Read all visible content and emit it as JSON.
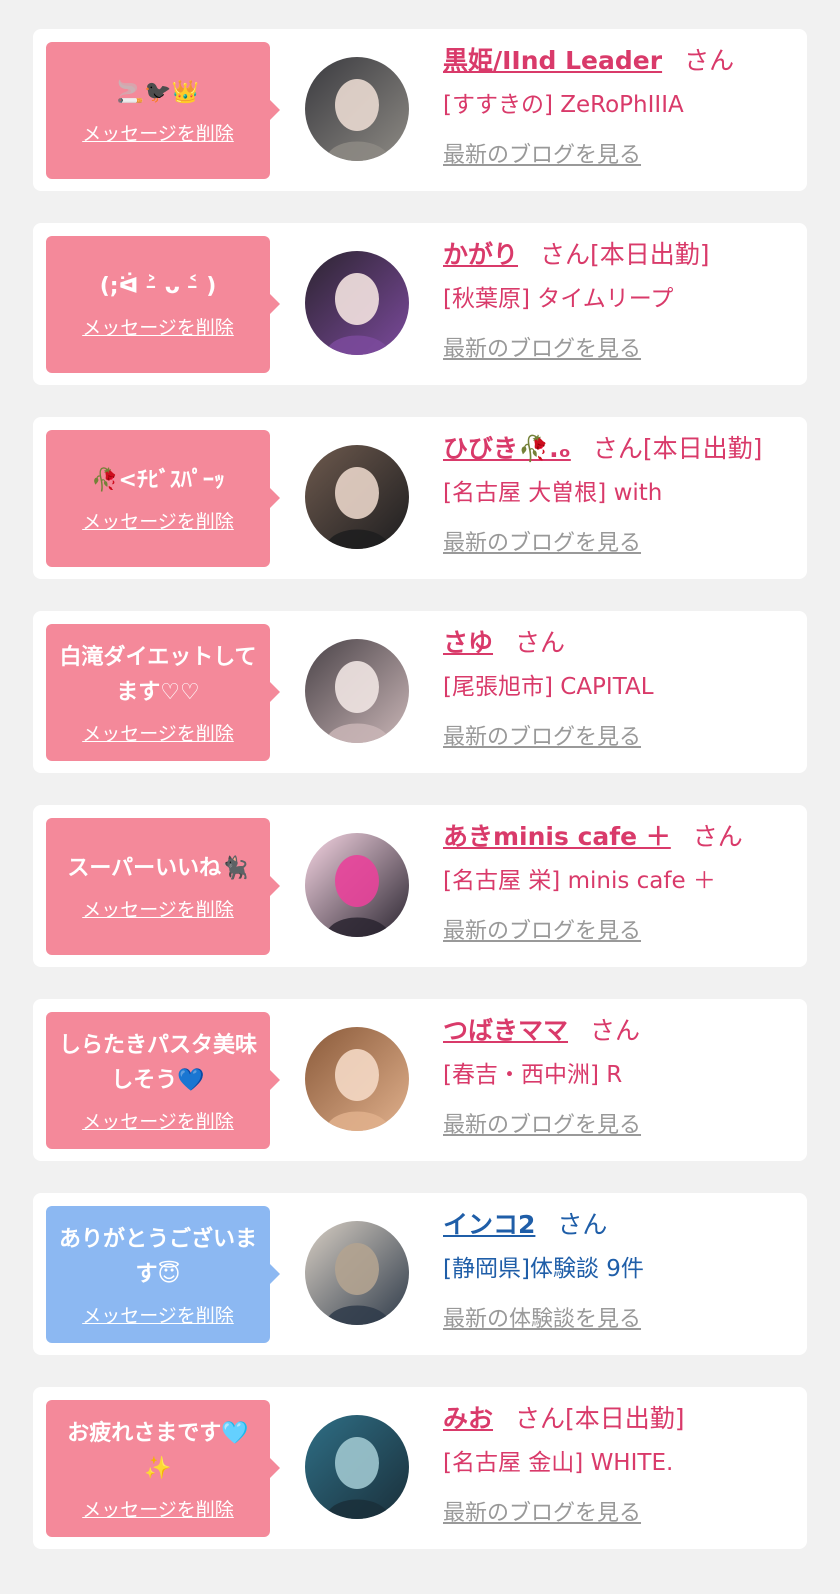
{
  "delete_label": "メッセージを削除",
  "colors": {
    "pink": "#f4899a",
    "blue": "#8cb8f2",
    "pink_text": "#d93a6a",
    "blue_text": "#1f5ea8",
    "link_gray": "#999999",
    "card_bg": "#ffffff",
    "page_bg": "#f1f1f1"
  },
  "honorific": "さん",
  "cards": [
    {
      "message": "🚬🐦‍⬛👑",
      "bubble_color": "pink",
      "name": "黒姫/IInd Leader",
      "status": "",
      "shop": "[すすきの] ZeRoPhIIIA",
      "link": "最新のブログを見る",
      "avatar": {
        "c1": "#3a3a3f",
        "c2": "#8d8a84",
        "c3": "#e9d9d0"
      }
    },
    {
      "message": "(;ᐛ ˃̵ ᴗ ˂̵ )",
      "bubble_color": "pink",
      "name": "かがり",
      "status": "[本日出勤]",
      "shop": "[秋葉原] タイムリープ",
      "link": "最新のブログを見る",
      "avatar": {
        "c1": "#2c2430",
        "c2": "#7b4a9c",
        "c3": "#f3e2e0"
      }
    },
    {
      "message": "🥀<ﾁﾋﾞｽﾊﾟｰｯ",
      "bubble_color": "pink",
      "name": "ひびき🥀.ₒ",
      "status": "[本日出勤]",
      "shop": "[名古屋 大曽根] with",
      "link": "最新のブログを見る",
      "avatar": {
        "c1": "#6e5a4e",
        "c2": "#1d1d1f",
        "c3": "#e8d4c8"
      }
    },
    {
      "message": "白滝ダイエットしてます♡♡",
      "bubble_color": "pink",
      "name": "さゆ",
      "status": "",
      "shop": "[尾張旭市] CAPITAL",
      "link": "最新のブログを見る",
      "avatar": {
        "c1": "#4a4348",
        "c2": "#c9b5b6",
        "c3": "#f0e4e2"
      }
    },
    {
      "message": "スーパーいいね🐈‍⬛",
      "bubble_color": "pink",
      "name": "あきminis cafe ＋",
      "status": "",
      "shop": "[名古屋 栄] minis cafe ＋",
      "link": "最新のブログを見る",
      "avatar": {
        "c1": "#f7d6e4",
        "c2": "#2a2530",
        "c3": "#e8439a"
      }
    },
    {
      "message": "しらたきパスタ美味しそう💙",
      "bubble_color": "pink",
      "name": "つばきママ",
      "status": "",
      "shop": "[春吉・西中洲] R",
      "link": "最新のブログを見る",
      "avatar": {
        "c1": "#8a5a3a",
        "c2": "#e0b08c",
        "c3": "#f4d8c4"
      }
    },
    {
      "message": "ありがとうございます😇",
      "bubble_color": "blue",
      "name": "インコ2",
      "status": "",
      "shop": "[静岡県]体験談 9件",
      "link": "最新の体験談を見る",
      "avatar": {
        "c1": "#d8cfc4",
        "c2": "#2f3b4a",
        "c3": "#b2a390"
      }
    },
    {
      "message": "お疲れさまです🩵✨",
      "bubble_color": "pink",
      "name": "みお",
      "status": "[本日出勤]",
      "shop": "[名古屋 金山] WHITE.",
      "link": "最新のブログを見る",
      "avatar": {
        "c1": "#2f6f86",
        "c2": "#1a2f3a",
        "c3": "#9fc7cf"
      }
    }
  ]
}
